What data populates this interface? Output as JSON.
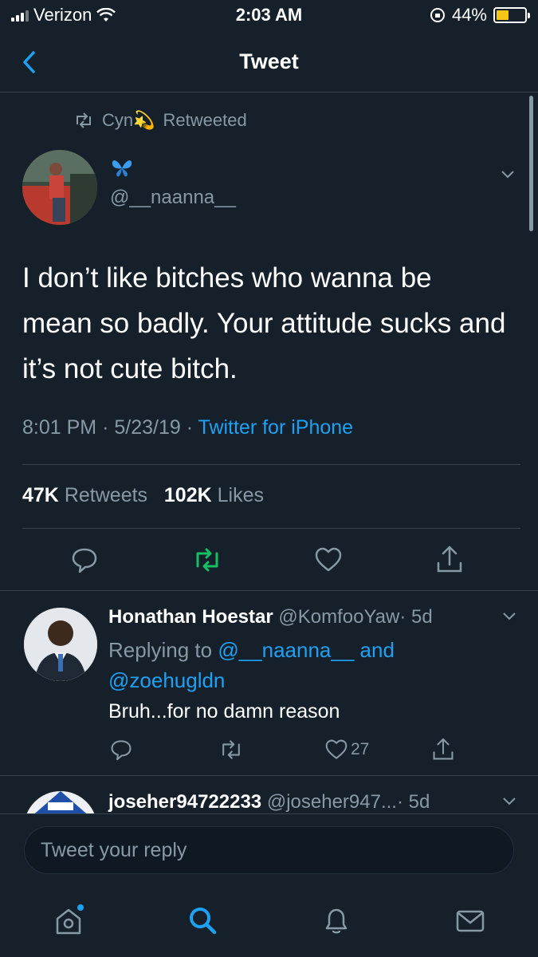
{
  "status_bar": {
    "carrier": "Verizon",
    "time": "2:03 AM",
    "battery_percent": "44%",
    "battery_level": 0.44
  },
  "nav": {
    "title": "Tweet",
    "back_icon": "chevron-left-icon"
  },
  "tweet": {
    "retweeted_by": "Cyn",
    "retweeted_by_emoji": "💫",
    "retweeted_label": "Retweeted",
    "author_name_emoji": "🦋",
    "author_handle": "@__naanna__",
    "text": "I don’t like bitches who wanna be mean so badly. Your attitude sucks and it’s not cute bitch.",
    "time": "8:01 PM",
    "date": "5/23/19",
    "source": "Twitter for iPhone",
    "sep": "·",
    "retweets_count": "47K",
    "retweets_label": "Retweets",
    "likes_count": "102K",
    "likes_label": "Likes"
  },
  "reply": {
    "name": "Honathan Hoestar",
    "handle": "@KomfooYaw",
    "age": "· 5d",
    "replying_prefix": "Replying to",
    "replying_to_1": "@__naanna__",
    "replying_and": "and",
    "replying_to_2": "@zoehugldn",
    "text": "Bruh...for no damn reason",
    "likes": "27"
  },
  "second_reply": {
    "name": "joseher94722233",
    "handle": "@joseher947...",
    "age": "· 5d"
  },
  "compose": {
    "placeholder": "Tweet your reply"
  },
  "tab_bar": {
    "home": "home-icon",
    "search": "search-icon",
    "notifications": "bell-icon",
    "messages": "mail-icon"
  },
  "colors": {
    "background": "#15202b",
    "accent": "#1da1f2",
    "retweet_active": "#17bf63",
    "muted": "#8899a6"
  }
}
